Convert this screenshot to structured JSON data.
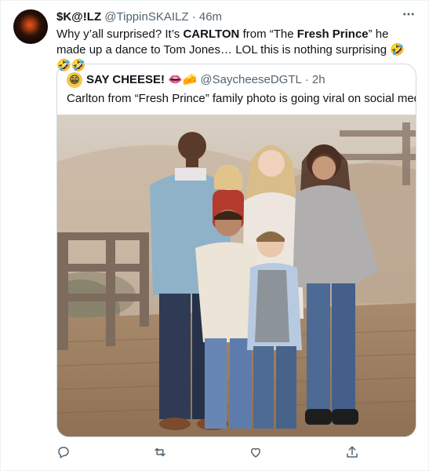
{
  "tweet": {
    "display_name": "$K@!LZ",
    "handle": "@TippinSKAILZ",
    "separator": "·",
    "time": "46m",
    "text_parts": {
      "a": "Why y’all surprised? It’s ",
      "b": "CARLTON",
      "c": " from “The ",
      "d": "Fresh Prince",
      "e": "” he made up a dance to Tom Jones… LOL this is nothing surprising ",
      "emoji": "🤣🤣🤣"
    },
    "more_icon": "more-horizontal-icon"
  },
  "quote": {
    "display_name": "SAY CHEESE!",
    "name_emoji": "👄🧀",
    "avatar_emoji": "😁",
    "handle": "@SaycheeseDGTL",
    "separator": "·",
    "time": "2h",
    "text": "Carlton from “Fresh Prince” family photo is going viral on social media",
    "image": "family-photo"
  },
  "actions": {
    "icons": [
      "reply-icon",
      "retweet-icon",
      "like-icon",
      "share-icon"
    ]
  }
}
